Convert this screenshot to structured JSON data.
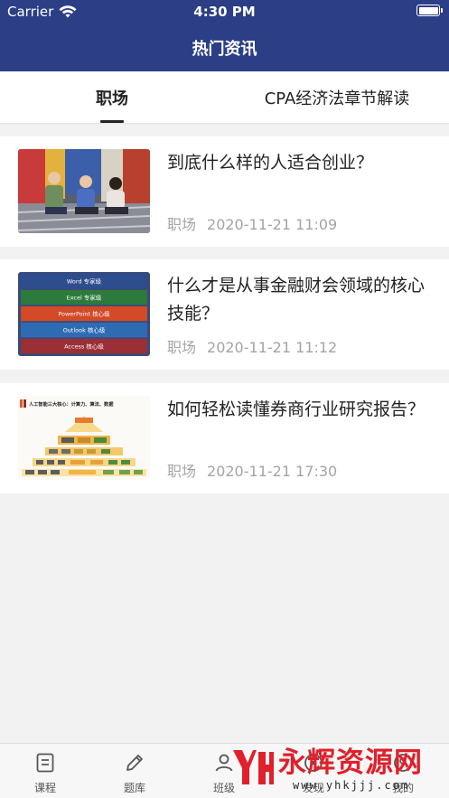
{
  "status_bar": {
    "carrier": "Carrier",
    "time": "4:30 PM"
  },
  "nav": {
    "title": "热门资讯"
  },
  "tabs": [
    {
      "label": "职场",
      "selected": true
    },
    {
      "label": "CPA经济法章节解读",
      "selected": false
    }
  ],
  "articles": [
    {
      "title": "到底什么样的人适合创业？",
      "category": "职场",
      "date": "2020-11-21 11:09"
    },
    {
      "title": "什么才是从事金融财会领域的核心技能？",
      "category": "职场",
      "date": "2020-11-21 11:12"
    },
    {
      "title": "如何轻松读懂券商行业研究报告？",
      "category": "职场",
      "date": "2020-11-21 17:30"
    }
  ],
  "thumb_office": {
    "bars": [
      {
        "label": "Word 专家级",
        "color": "#2d4d8c"
      },
      {
        "label": "Excel 专家级",
        "color": "#2c7a3c"
      },
      {
        "label": "PowerPoint 核心级",
        "color": "#d24a26"
      },
      {
        "label": "Outlook 核心级",
        "color": "#2f6bb3"
      },
      {
        "label": "Access 核心级",
        "color": "#9b2f35"
      }
    ]
  },
  "thumb_pyramid": {
    "heading": "人工智能三大核心：计算力、算法、数据"
  },
  "tabbar": {
    "items": [
      {
        "label": "课程",
        "icon": "document-icon"
      },
      {
        "label": "题库",
        "icon": "pencil-icon"
      },
      {
        "label": "班级",
        "icon": "person-icon"
      },
      {
        "label": "发现",
        "icon": "compass-icon"
      },
      {
        "label": "我的",
        "icon": "profile-icon"
      }
    ]
  },
  "watermark": {
    "text": "永辉资源网",
    "url": "www.yhkjjj.com"
  },
  "colors": {
    "header": "#2b3e86",
    "watermark": "#e0202b"
  }
}
